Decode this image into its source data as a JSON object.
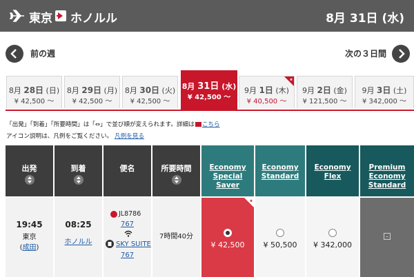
{
  "header": {
    "from": "東京",
    "to": "ホノルル",
    "date_month": "8月",
    "date_day": "31日",
    "date_weekday": "(水)"
  },
  "nav": {
    "prev_label": "前の週",
    "next_label": "次の３日間"
  },
  "date_tabs": [
    {
      "month": "8月",
      "day": "28日",
      "weekday": "(日)",
      "price": "¥ 42,500 〜"
    },
    {
      "month": "8月",
      "day": "29日",
      "weekday": "(月)",
      "price": "¥ 42,500 〜"
    },
    {
      "month": "8月",
      "day": "30日",
      "weekday": "(火)",
      "price": "¥ 42,500 〜"
    },
    {
      "month": "8月",
      "day": "31日",
      "weekday": "(水)",
      "price": "¥ 42,500 〜"
    },
    {
      "month": "9月",
      "day": "1日",
      "weekday": "(木)",
      "price": "¥ 40,500 〜"
    },
    {
      "month": "9月",
      "day": "2日",
      "weekday": "(金)",
      "price": "¥ 121,500 〜"
    },
    {
      "month": "9月",
      "day": "3日",
      "weekday": "(土)",
      "price": "¥ 342,000 〜"
    }
  ],
  "notes": {
    "sort_note": "「出発」「到着」「所要時間」は「⇔」で並び順が変えられます。詳細は",
    "sort_link": "こちら",
    "legend_note": "アイコン説明は、凡例をご覧ください。",
    "legend_link": "凡例を見る"
  },
  "table": {
    "headers": {
      "departure": "出発",
      "arrival": "到着",
      "flight": "便名",
      "duration": "所要時間",
      "fare1": "Economy Special Saver",
      "fare2": "Economy Standard",
      "fare3": "Economy Flex",
      "fare4": "Premium Economy Standard"
    },
    "row": {
      "dep_time": "19:45",
      "dep_city": "東京",
      "dep_airport_open": "(",
      "dep_airport": "成田",
      "dep_airport_close": ")",
      "arr_time": "08:25",
      "arr_city": "ホノルル",
      "flight_no": "JL8786",
      "aircraft1": "767",
      "seat": "SKY SUITE",
      "aircraft2": "767",
      "duration": "7時間40分",
      "price1": "¥ 42,500",
      "price2": "¥ 50,500",
      "price3": "¥ 342,000"
    }
  },
  "colors": {
    "brand_red": "#c8162a",
    "teal": "#2e7b7d",
    "dark_header": "#3d3d3d"
  }
}
